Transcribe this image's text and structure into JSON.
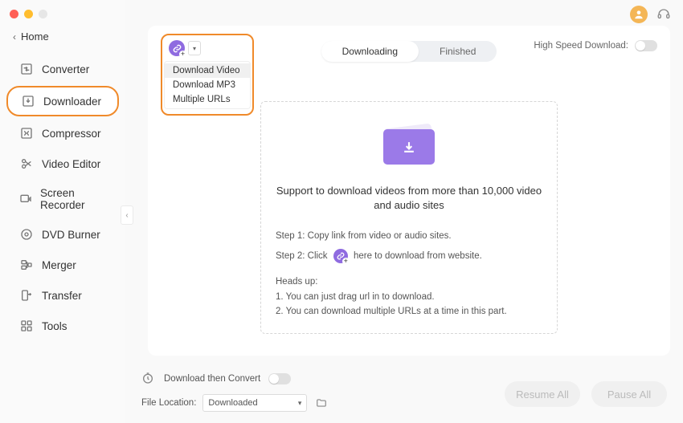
{
  "sidebar": {
    "home": "Home",
    "items": [
      {
        "label": "Converter"
      },
      {
        "label": "Downloader"
      },
      {
        "label": "Compressor"
      },
      {
        "label": "Video Editor"
      },
      {
        "label": "Screen Recorder"
      },
      {
        "label": "DVD Burner"
      },
      {
        "label": "Merger"
      },
      {
        "label": "Transfer"
      },
      {
        "label": "Tools"
      }
    ]
  },
  "paste_menu": {
    "items": [
      {
        "label": "Download Video"
      },
      {
        "label": "Download MP3"
      },
      {
        "label": "Multiple URLs"
      }
    ]
  },
  "tabs": {
    "downloading": "Downloading",
    "finished": "Finished"
  },
  "hsd_label": "High Speed Download:",
  "empty": {
    "desc": "Support to download videos from more than 10,000 video and audio sites",
    "step1": "Step 1: Copy link from video or audio sites.",
    "step2_a": "Step 2: Click",
    "step2_b": "here to download from website.",
    "heads_up_title": "Heads up:",
    "heads_up_1": "1. You can just drag url in to download.",
    "heads_up_2": "2. You can download multiple URLs at a time in this part."
  },
  "footer": {
    "dtc": "Download then Convert",
    "file_loc_label": "File Location:",
    "file_loc_value": "Downloaded",
    "resume": "Resume All",
    "pause": "Pause All"
  }
}
